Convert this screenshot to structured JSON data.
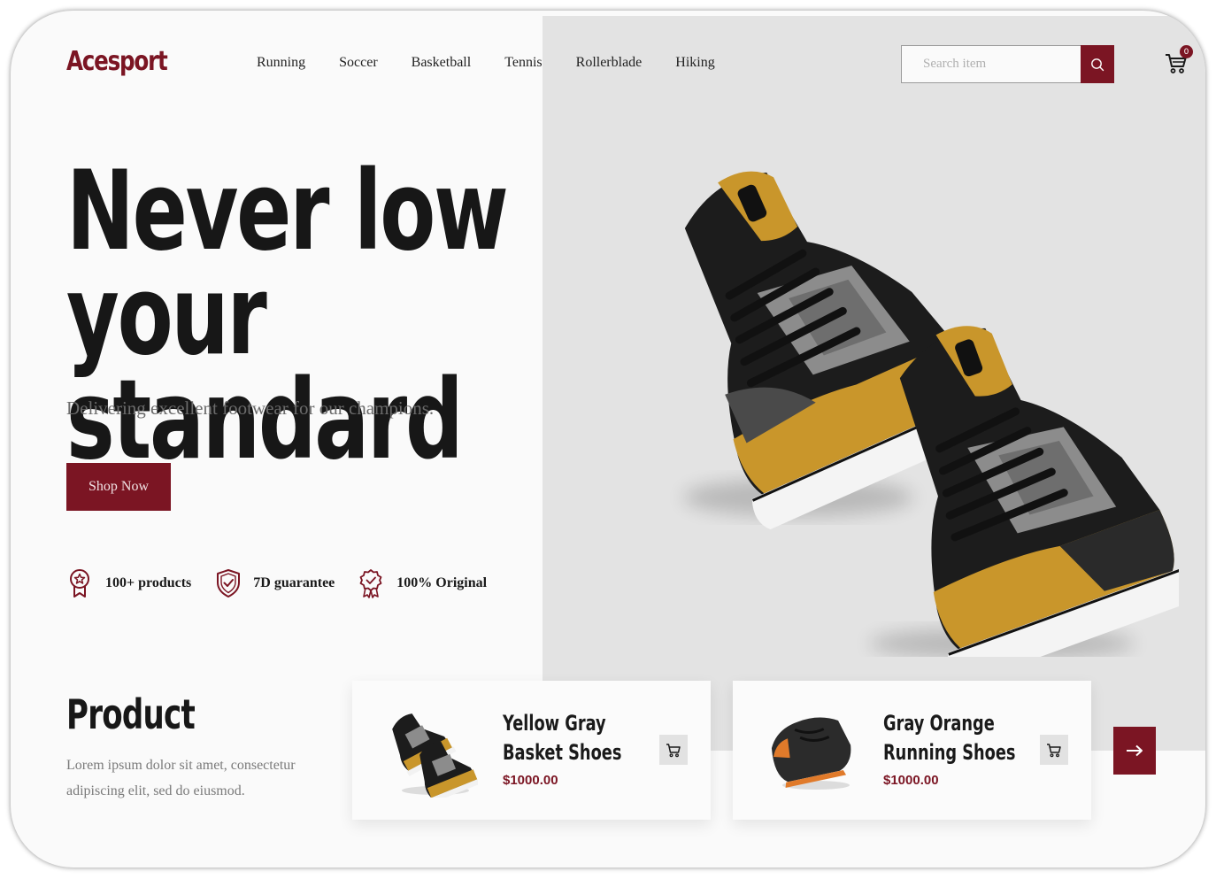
{
  "brand": {
    "logo_text": "Acesport",
    "accent_color": "#7b1523",
    "panel_color": "#e3e3e3"
  },
  "nav": {
    "items": [
      {
        "label": "Running"
      },
      {
        "label": "Soccer"
      },
      {
        "label": "Basketball"
      },
      {
        "label": "Tennis"
      },
      {
        "label": "Rollerblade"
      },
      {
        "label": "Hiking"
      }
    ]
  },
  "search": {
    "placeholder": "Search item",
    "value": "",
    "button_icon": "search-icon"
  },
  "cart": {
    "icon": "cart-icon",
    "count": "0"
  },
  "hero": {
    "title_line1": "Never low your",
    "title_line2": "standard",
    "subtitle": "Delivering excellent footwear for our champions.",
    "cta_label": "Shop Now",
    "image_icon": "sneakers-pair-image"
  },
  "features": [
    {
      "icon": "badge-star-icon",
      "label": "100+ products"
    },
    {
      "icon": "shield-check-icon",
      "label": "7D guarantee"
    },
    {
      "icon": "certified-badge-icon",
      "label": "100% Original"
    }
  ],
  "products_section": {
    "heading": "Product",
    "description": "Lorem ipsum dolor sit amet, consectetur adipiscing elit, sed do eiusmod.",
    "next_icon": "arrow-right-icon",
    "items": [
      {
        "name": "Yellow Gray Basket Shoes",
        "price": "$1000.00",
        "icon": "cart-icon"
      },
      {
        "name": "Gray Orange Running Shoes",
        "price": "$1000.00",
        "icon": "cart-icon"
      }
    ]
  }
}
